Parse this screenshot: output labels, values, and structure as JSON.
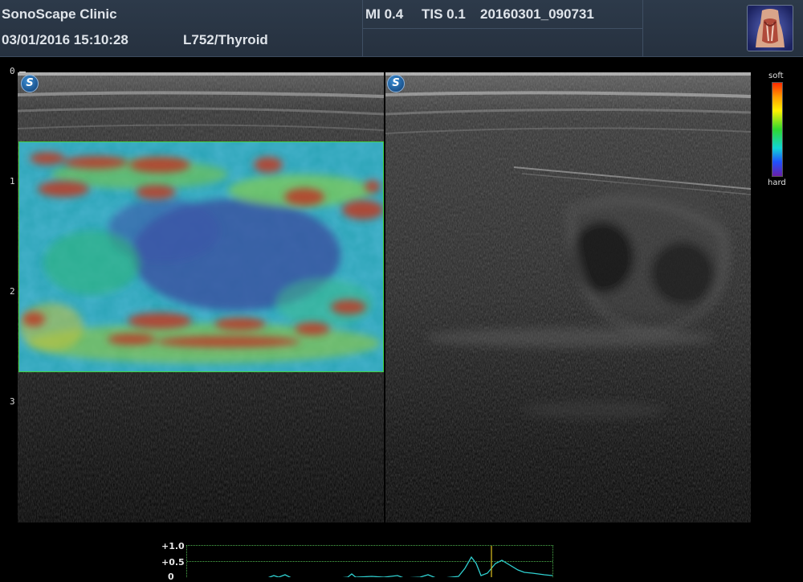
{
  "header": {
    "clinic_name": "SonoScape Clinic",
    "datetime": "03/01/2016 15:10:28",
    "probe_preset": "L752/Thyroid",
    "mi": "MI  0.4",
    "tis": "TIS 0.1",
    "file_id": "20160301_090731"
  },
  "depth_scale": [
    "0",
    "1",
    "2",
    "3"
  ],
  "panes": {
    "left_badge": "S",
    "right_badge": "S"
  },
  "color_bar": {
    "top_label": "soft",
    "bottom_label": "hard",
    "colors": [
      "#ff2a00",
      "#fff200",
      "#2fd82f",
      "#11d6d6",
      "#6a1fa8"
    ]
  },
  "strain_graph": {
    "labels": [
      "+1.0",
      "+0.5",
      "0"
    ]
  },
  "colors": {
    "header_bg": "#2a3545",
    "roi_border": "#3fd23f",
    "graph_line": "#2fd0d0",
    "marker": "#e0c020"
  }
}
